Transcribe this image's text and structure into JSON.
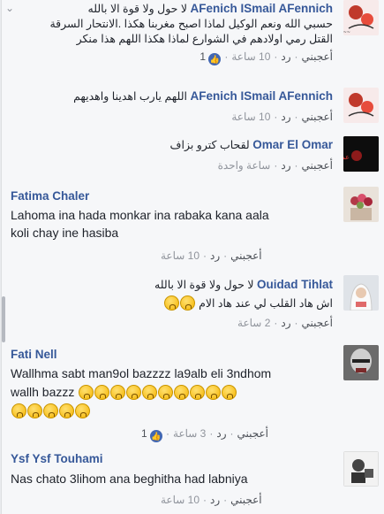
{
  "actions": {
    "like": "أعجبني",
    "reply": "رد",
    "dot": "·"
  },
  "comments": [
    {
      "author": "AFenich ISmail AFennich",
      "line1_text": "لا حول ولا قوة الا بالله",
      "line2": "حسبي الله ونعم الوكيل لماذا اصبح مغربنا هكذا .الانتحار السرقة",
      "line3": "القتل رمي اولادهم في الشوارع لماذا هكذا اللهم هذا منكر",
      "time": "10 ساعة",
      "likes": "1"
    },
    {
      "author": "AFenich ISmail AFennich",
      "line1_text": "اللهم يارب اهدينا واهديهم",
      "time": "10 ساعة"
    },
    {
      "author": "Omar El Omar",
      "line1_text": "لقحاب كترو بزاف",
      "time": "ساعة واحدة"
    },
    {
      "author": "Fatima Chaler",
      "line2": "Lahoma ina hada monkar ina rabaka kana aala",
      "line3": "koli chay ine hasiba",
      "time": "10 ساعة"
    },
    {
      "author": "Ouidad Tihlat",
      "line1_text": "لا حول ولا قوة الا بالله",
      "line2": "اش هاد القلب لي عند هاد الام",
      "time": "2 ساعة"
    },
    {
      "author": "Fati Nell",
      "line2": "Wallhma sabt man9ol bazzzz la9alb eli 3ndhom",
      "line3": "wallh bazzz",
      "time": "3 ساعة",
      "likes": "1"
    },
    {
      "author": "Ysf Ysf Touhami",
      "line2": "Nas chato 3lihom ana beghitha had labniya",
      "time": "10 ساعة"
    }
  ],
  "icons": {
    "like_badge": "thumbs-up-icon",
    "emoji": "crying-face-icon"
  },
  "colors": {
    "name": "#365899",
    "text": "#1d2129",
    "meta": "#90949c",
    "bg": "#f6f7f9"
  }
}
